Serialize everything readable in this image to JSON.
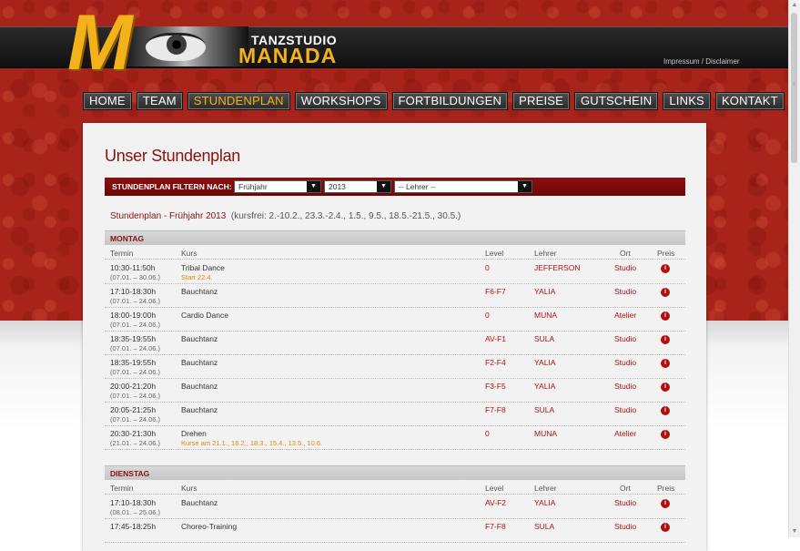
{
  "header": {
    "brand_small": "TANZSTUDIO",
    "brand_big": "MANADA",
    "logo_letter": "M",
    "impressum_link": "Impressum / Disclaimer"
  },
  "nav": [
    "HOME",
    "TEAM",
    "STUNDENPLAN",
    "WORKSHOPS",
    "FORTBILDUNGEN",
    "PREISE",
    "GUTSCHEIN",
    "LINKS",
    "KONTAKT"
  ],
  "nav_active": "STUNDENPLAN",
  "page": {
    "title": "Unser Stundenplan",
    "filter_label": "STUNDENPLAN FILTERN NACH:",
    "season_select": "Frühjahr",
    "year_select": "2013",
    "teacher_select": "-- Lehrer --",
    "plan_heading": "Stundenplan - Frühjahr 2013",
    "plan_note": "(kursfrei: 2.-10.2., 23.3.-2.4., 1.5., 9.5., 18.5.-21.5., 30.5.)"
  },
  "columns": {
    "termin": "Termin",
    "kurs": "Kurs",
    "level": "Level",
    "lehrer": "Lehrer",
    "ort": "Ort",
    "preis": "Preis"
  },
  "days": [
    {
      "name": "MONTAG",
      "rows": [
        {
          "time": "10:30-11:50h",
          "date": "(07.01. – 30.06.)",
          "kurs": "Tribal Dance",
          "kurs_note": "Start 22.4.",
          "level": "0",
          "lehrer": "JEFFERSON",
          "ort": "Studio"
        },
        {
          "time": "17:10-18:30h",
          "date": "(07.01. – 24.06.)",
          "kurs": "Bauchtanz",
          "kurs_note": "",
          "level": "F6-F7",
          "lehrer": "YALIA",
          "ort": "Studio"
        },
        {
          "time": "18:00-19:00h",
          "date": "(07.01. – 24.06.)",
          "kurs": "Cardio Dance",
          "kurs_note": "",
          "level": "0",
          "lehrer": "MUNA",
          "ort": "Atelier"
        },
        {
          "time": "18:35-19:55h",
          "date": "(07.01. – 24.06.)",
          "kurs": "Bauchtanz",
          "kurs_note": "",
          "level": "AV-F1",
          "lehrer": "SULA",
          "ort": "Studio"
        },
        {
          "time": "18:35-19:55h",
          "date": "(07.01. – 24.06.)",
          "kurs": "Bauchtanz",
          "kurs_note": "",
          "level": "F2-F4",
          "lehrer": "YALIA",
          "ort": "Studio"
        },
        {
          "time": "20:00-21:20h",
          "date": "(07.01. – 24.06.)",
          "kurs": "Bauchtanz",
          "kurs_note": "",
          "level": "F3-F5",
          "lehrer": "YALIA",
          "ort": "Studio"
        },
        {
          "time": "20:05-21:25h",
          "date": "(07.01. – 24.06.)",
          "kurs": "Bauchtanz",
          "kurs_note": "",
          "level": "F7-F8",
          "lehrer": "SULA",
          "ort": "Studio"
        },
        {
          "time": "20:30-21:30h",
          "date": "(21.01. – 24.06.)",
          "kurs": "Drehen",
          "kurs_note": "Kurse am 21.1., 18.2., 18.3., 15.4., 13.5., 10.6.",
          "level": "0",
          "lehrer": "MUNA",
          "ort": "Atelier"
        }
      ]
    },
    {
      "name": "DIENSTAG",
      "rows": [
        {
          "time": "17:10-18:30h",
          "date": "(08.01. – 25.06.)",
          "kurs": "Bauchtanz",
          "kurs_note": "",
          "level": "AV-F2",
          "lehrer": "YALIA",
          "ort": "Studio"
        },
        {
          "time": "17:45-18:25h",
          "date": "",
          "kurs": "Choreo-Training",
          "kurs_note": "",
          "level": "F7-F8",
          "lehrer": "SULA",
          "ort": "Studio"
        }
      ]
    }
  ],
  "info_icon": "info-icon"
}
